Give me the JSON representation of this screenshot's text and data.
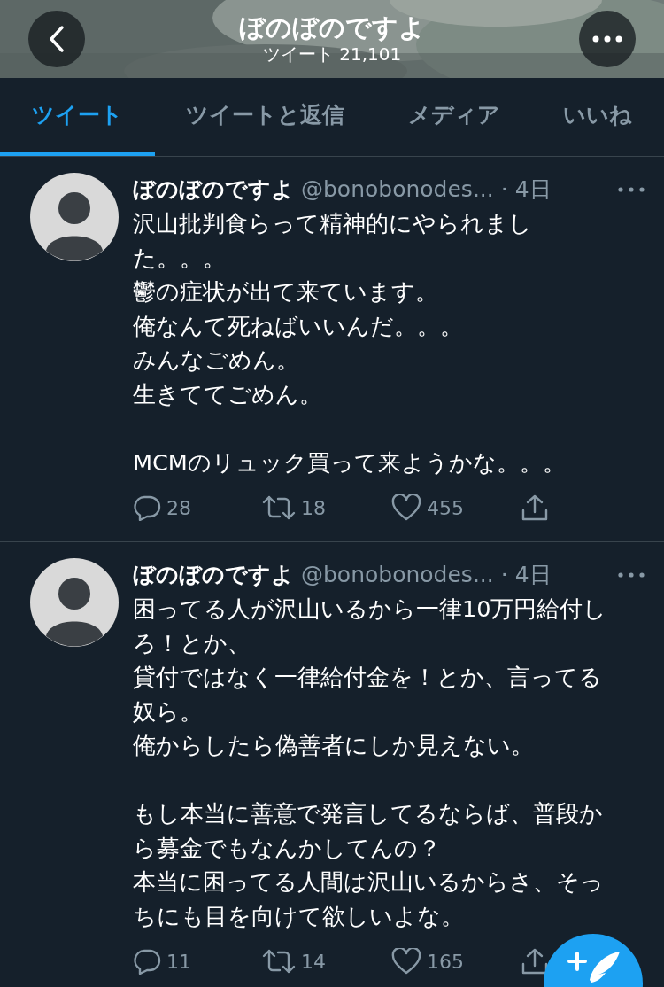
{
  "header": {
    "title": "ぼのぼのですよ",
    "subtitle": "ツイート 21,101"
  },
  "tabs": [
    {
      "label": "ツイート",
      "selected": true
    },
    {
      "label": "ツイートと返信",
      "selected": false
    },
    {
      "label": "メディア",
      "selected": false
    },
    {
      "label": "いいね",
      "selected": false
    }
  ],
  "tweets": [
    {
      "name": "ぼのぼのですよ",
      "handle": "@bonobonodes...",
      "time": "· 4日",
      "paragraphs": [
        [
          "沢山批判食らって精神的にやられまし",
          "た。。。",
          "鬱の症状が出て来ています。",
          "俺なんて死ねばいいんだ。。。",
          "みんなごめん。",
          "生きててごめん。"
        ],
        [
          "MCMのリュック買って来ようかな。。。"
        ]
      ],
      "replies": "28",
      "retweets": "18",
      "likes": "455"
    },
    {
      "name": "ぼのぼのですよ",
      "handle": "@bonobonodes...",
      "time": "· 4日",
      "paragraphs": [
        [
          "困ってる人が沢山いるから一律10万円給付し",
          "ろ！とか、",
          "貸付ではなく一律給付金を！とか、言ってる",
          "奴ら。",
          "俺からしたら偽善者にしか見えない。"
        ],
        [
          "もし本当に善意で発言してるならば、普段か",
          "ら募金でもなんかしてんの？",
          "本当に困ってる人間は沢山いるからさ、そっ",
          "ちにも目を向けて欲しいよな。"
        ]
      ],
      "replies": "11",
      "retweets": "14",
      "likes": "165"
    }
  ]
}
